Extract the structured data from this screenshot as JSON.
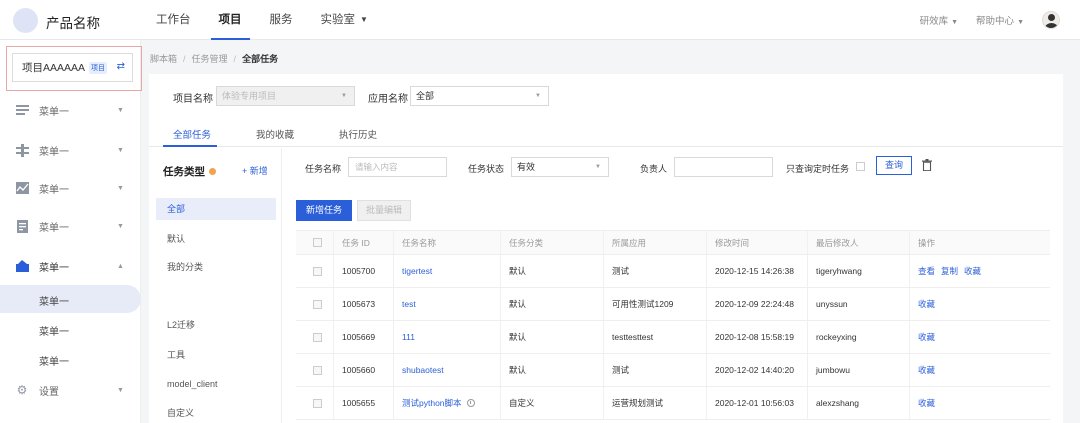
{
  "topbar": {
    "product_name": "产品名称",
    "nav": [
      "工作台",
      "项目",
      "服务",
      "实验室"
    ],
    "right": [
      "研效库",
      "帮助中心"
    ]
  },
  "sidebar": {
    "project_name": "项目AAAAAA",
    "project_tag": "项目",
    "menus": [
      {
        "label": "菜单一",
        "icon": "stack-icon"
      },
      {
        "label": "菜单一",
        "icon": "network-icon"
      },
      {
        "label": "菜单一",
        "icon": "chart-icon"
      },
      {
        "label": "菜单一",
        "icon": "document-icon"
      },
      {
        "label": "菜单一",
        "icon": "box-icon"
      }
    ],
    "sub_items": [
      "菜单一",
      "菜单一",
      "菜单一"
    ],
    "settings_label": "设置"
  },
  "breadcrumb": [
    "脚本箱",
    "任务管理",
    "全部任务"
  ],
  "filters": {
    "project_label": "项目名称",
    "project_value": "体验专用项目",
    "app_label": "应用名称",
    "app_value": "全部"
  },
  "tabs": [
    "全部任务",
    "我的收藏",
    "执行历史"
  ],
  "types": {
    "title": "任务类型",
    "new": "+ 新增",
    "items": [
      "全部",
      "默认",
      "我的分类",
      "L2迁移",
      "工具",
      "model_client",
      "自定义"
    ]
  },
  "task_filters": {
    "name_label": "任务名称",
    "name_placeholder": "请输入内容",
    "status_label": "任务状态",
    "status_value": "有效",
    "owner_label": "负责人",
    "timed_label": "只查询定时任务",
    "query_button": "查询"
  },
  "actions": {
    "new_task": "新增任务",
    "batch_edit": "批量编辑"
  },
  "table": {
    "headers": [
      "任务 ID",
      "任务名称",
      "任务分类",
      "所属应用",
      "修改时间",
      "最后修改人",
      "操作"
    ],
    "rows": [
      {
        "id": "1005700",
        "name": "tigertest",
        "category": "默认",
        "app": "测试",
        "time": "2020-12-15 14:26:38",
        "user": "tigeryhwang",
        "ops": [
          "查看",
          "复制",
          "收藏"
        ]
      },
      {
        "id": "1005673",
        "name": "test",
        "category": "默认",
        "app": "可用性测试1209",
        "time": "2020-12-09 22:24:48",
        "user": "unyssun",
        "ops": [
          "收藏"
        ]
      },
      {
        "id": "1005669",
        "name": "111",
        "category": "默认",
        "app": "testtesttest",
        "time": "2020-12-08 15:58:19",
        "user": "rockeyxing",
        "ops": [
          "收藏"
        ]
      },
      {
        "id": "1005660",
        "name": "shubaotest",
        "category": "默认",
        "app": "测试",
        "time": "2020-12-02 14:40:20",
        "user": "jumbowu",
        "ops": [
          "收藏"
        ]
      },
      {
        "id": "1005655",
        "name": "测试python脚本",
        "category": "自定义",
        "app": "运营规划测试",
        "time": "2020-12-01 10:56:03",
        "user": "alexzshang",
        "ops": [
          "收藏"
        ]
      }
    ]
  }
}
